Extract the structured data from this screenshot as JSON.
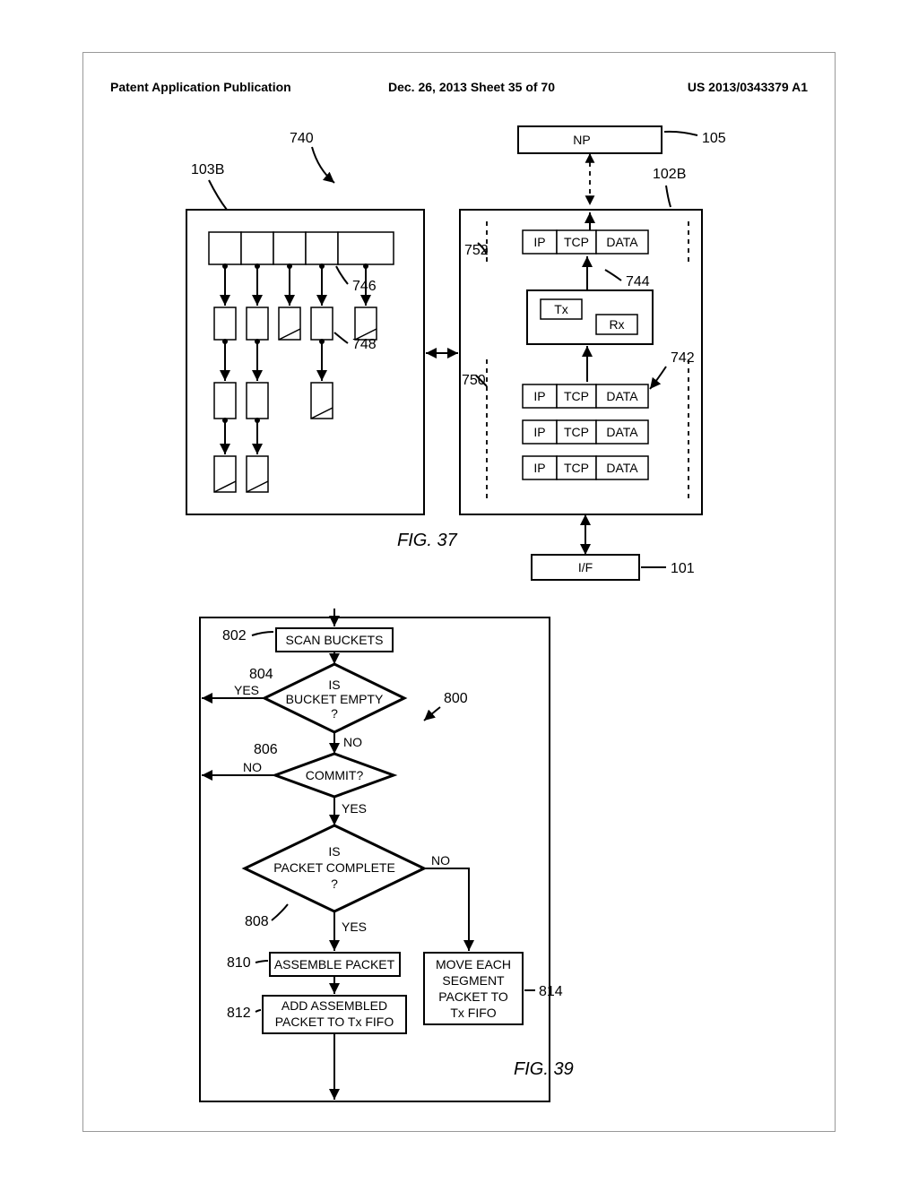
{
  "header": {
    "left": "Patent Application Publication",
    "mid": "Dec. 26, 2013  Sheet 35 of 70",
    "right": "US 2013/0343379 A1"
  },
  "fig37": {
    "caption": "FIG. 37",
    "labels": {
      "l740": "740",
      "l103B": "103B",
      "l746": "746",
      "l748": "748",
      "l105": "105",
      "NP": "NP",
      "l102B": "102B",
      "l752": "752",
      "l744": "744",
      "Tx": "Tx",
      "Rx": "Rx",
      "l750": "750",
      "l742": "742",
      "l101": "101",
      "IF": "I/F"
    },
    "packet_row": {
      "ip": "IP",
      "tcp": "TCP",
      "data": "DATA"
    }
  },
  "fig39": {
    "caption": "FIG. 39",
    "labels": {
      "l800": "800",
      "l802": "802",
      "l804": "804",
      "l806": "806",
      "l808": "808",
      "l810": "810",
      "l812": "812",
      "l814": "814"
    },
    "steps": {
      "scan": "SCAN BUCKETS",
      "is_empty": "IS\nBUCKET EMPTY\n?",
      "commit": "COMMIT?",
      "is_complete": "IS\nPACKET COMPLETE\n?",
      "assemble": "ASSEMBLE PACKET",
      "add": "ADD ASSEMBLED\nPACKET TO Tx FIFO",
      "move": "MOVE EACH\nSEGMENT\nPACKET TO\nTx FIFO"
    },
    "branches": {
      "yes": "YES",
      "no": "NO"
    }
  },
  "chart_data": {
    "type": "diagram",
    "figures": [
      {
        "id": "FIG. 37",
        "description": "Block diagram of two modules (103B and 102B) exchanging packets. Module 103B shows a tree queue (746) feeding stages (748). Module 102B has a Tx/Rx block (744) exchanging IP/TCP/DATA packets (742, 750, 752) with NP (105) above and I/F (101) below.",
        "elements": [
          {
            "ref": "740",
            "desc": "callout arrow to top of diagram"
          },
          {
            "ref": "103B",
            "desc": "left processing block with queues"
          },
          {
            "ref": "746",
            "desc": "row of input queue slots"
          },
          {
            "ref": "748",
            "desc": "second-row buffers"
          },
          {
            "ref": "102B",
            "desc": "right network block"
          },
          {
            "ref": "105",
            "desc": "NP block (network processor)"
          },
          {
            "ref": "744",
            "desc": "Tx/Rx sub-block"
          },
          {
            "ref": "752",
            "desc": "upper packet row IP|TCP|DATA"
          },
          {
            "ref": "750",
            "desc": "lower packet rows dashed region"
          },
          {
            "ref": "742",
            "desc": "label arrow to packet stack"
          },
          {
            "ref": "101",
            "desc": "I/F block (interface)"
          }
        ]
      },
      {
        "id": "FIG. 39",
        "ref": "800",
        "description": "Flowchart: SCAN BUCKETS → IS BUCKET EMPTY? (YES loop back / NO) → COMMIT? (NO loop back / YES) → IS PACKET COMPLETE? (YES → ASSEMBLE PACKET → ADD ASSEMBLED PACKET TO Tx FIFO; NO → MOVE EACH SEGMENT PACKET TO Tx FIFO)",
        "nodes": [
          {
            "ref": "802",
            "type": "process",
            "text": "SCAN BUCKETS"
          },
          {
            "ref": "804",
            "type": "decision",
            "text": "IS BUCKET EMPTY ?",
            "yes": "loop",
            "no": "806"
          },
          {
            "ref": "806",
            "type": "decision",
            "text": "COMMIT?",
            "yes": "808",
            "no": "loop"
          },
          {
            "ref": "808",
            "type": "decision",
            "text": "IS PACKET COMPLETE ?",
            "yes": "810",
            "no": "814"
          },
          {
            "ref": "810",
            "type": "process",
            "text": "ASSEMBLE PACKET"
          },
          {
            "ref": "812",
            "type": "process",
            "text": "ADD ASSEMBLED PACKET TO Tx FIFO"
          },
          {
            "ref": "814",
            "type": "process",
            "text": "MOVE EACH SEGMENT PACKET TO Tx FIFO"
          }
        ]
      }
    ]
  }
}
